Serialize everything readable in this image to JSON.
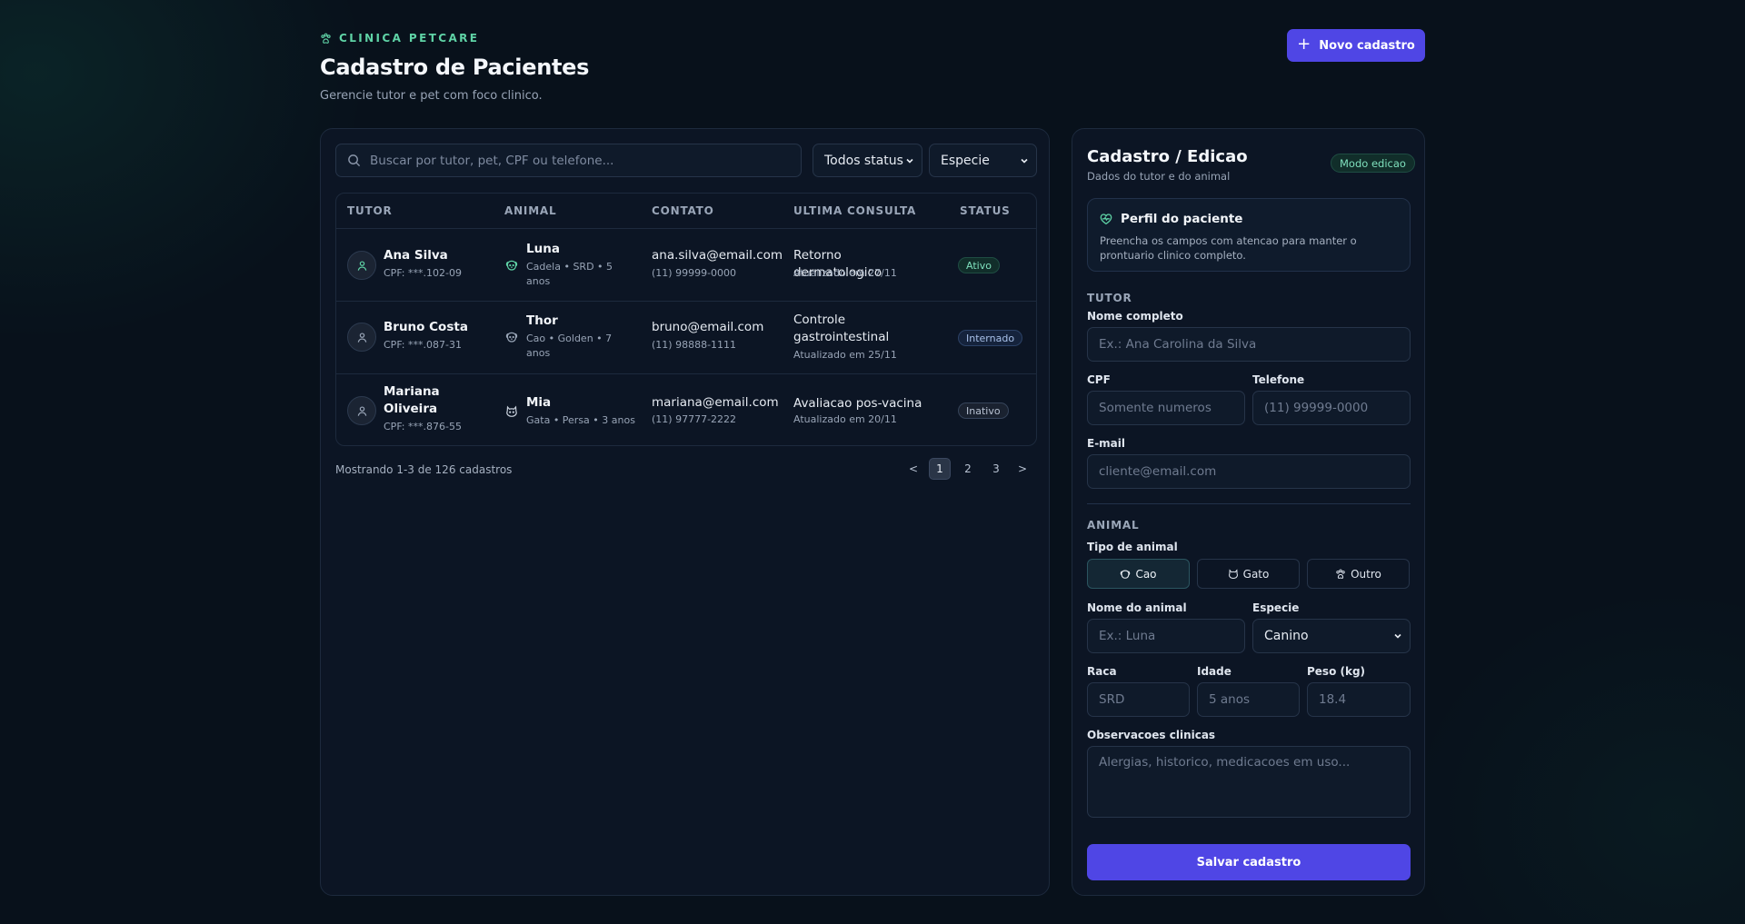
{
  "header": {
    "brand": "CLINICA PETCARE",
    "title": "Cadastro de Pacientes",
    "subtitle": "Gerencie tutor e pet com foco clinico.",
    "new_button": "Novo cadastro"
  },
  "filters": {
    "search_placeholder": "Buscar por tutor, pet, CPF ou telefone...",
    "status_value": "Todos status",
    "species_value": "Especie"
  },
  "table": {
    "columns": [
      "TUTOR",
      "ANIMAL",
      "CONTATO",
      "ULTIMA CONSULTA",
      "STATUS"
    ],
    "rows": [
      {
        "tutor": "Ana Silva",
        "cpf": "CPF: ***.102-09",
        "pet": "Luna",
        "pet_meta": "Cadela • SRD • 5 anos",
        "pet_icon": "dog-icon",
        "email": "ana.silva@email.com",
        "phone": "(11) 99999-0000",
        "visit": "Retorno dermatologico",
        "visit_date": "Atualizado em 27/11",
        "status": "Ativo"
      },
      {
        "tutor": "Bruno Costa",
        "cpf": "CPF: ***.087-31",
        "pet": "Thor",
        "pet_meta": "Cao • Golden • 7 anos",
        "pet_icon": "dog-icon",
        "email": "bruno@email.com",
        "phone": "(11) 98888-1111",
        "visit": "Controle gastrointestinal",
        "visit_date": "Atualizado em 25/11",
        "status": "Internado"
      },
      {
        "tutor": "Mariana Oliveira",
        "cpf": "CPF: ***.876-55",
        "pet": "Mia",
        "pet_meta": "Gata • Persa • 3 anos",
        "pet_icon": "cat-icon",
        "email": "mariana@email.com",
        "phone": "(11) 97777-2222",
        "visit": "Avaliacao pos-vacina",
        "visit_date": "Atualizado em 20/11",
        "status": "Inativo"
      }
    ]
  },
  "pagination": {
    "summary": "Mostrando 1-3 de 126 cadastros",
    "prev": "<",
    "pages": [
      "1",
      "2",
      "3"
    ],
    "current": "1",
    "next": ">"
  },
  "form": {
    "title": "Cadastro / Edicao",
    "subtitle": "Dados do tutor e do animal",
    "mode_badge": "Modo edicao",
    "profile_title": "Perfil do paciente",
    "profile_desc": "Preencha os campos com atencao para manter o prontuario clinico completo.",
    "tutor_section": "TUTOR",
    "full_name_label": "Nome completo",
    "full_name_placeholder": "Ex.: Ana Carolina da Silva",
    "cpf_label": "CPF",
    "cpf_placeholder": "Somente numeros",
    "phone_label": "Telefone",
    "phone_placeholder": "(11) 99999-0000",
    "email_label": "E-mail",
    "email_placeholder": "cliente@email.com",
    "animal_section": "ANIMAL",
    "animal_type_label": "Tipo de animal",
    "animal_types": [
      "Cao",
      "Gato",
      "Outro"
    ],
    "animal_type_selected": "Cao",
    "animal_name_label": "Nome do animal",
    "animal_name_placeholder": "Ex.: Luna",
    "species_label": "Especie",
    "species_value": "Canino",
    "breed_label": "Raca",
    "breed_placeholder": "SRD",
    "age_label": "Idade",
    "age_placeholder": "5 anos",
    "weight_label": "Peso (kg)",
    "weight_placeholder": "18.4",
    "notes_label": "Observacoes clinicas",
    "notes_placeholder": "Alergias, historico, medicacoes em uso...",
    "save_button": "Salvar cadastro"
  },
  "colors": {
    "background": "#08111b",
    "panel": "#0c1524",
    "accent": "#4f46e5",
    "brand_green": "#5fd3a6"
  }
}
